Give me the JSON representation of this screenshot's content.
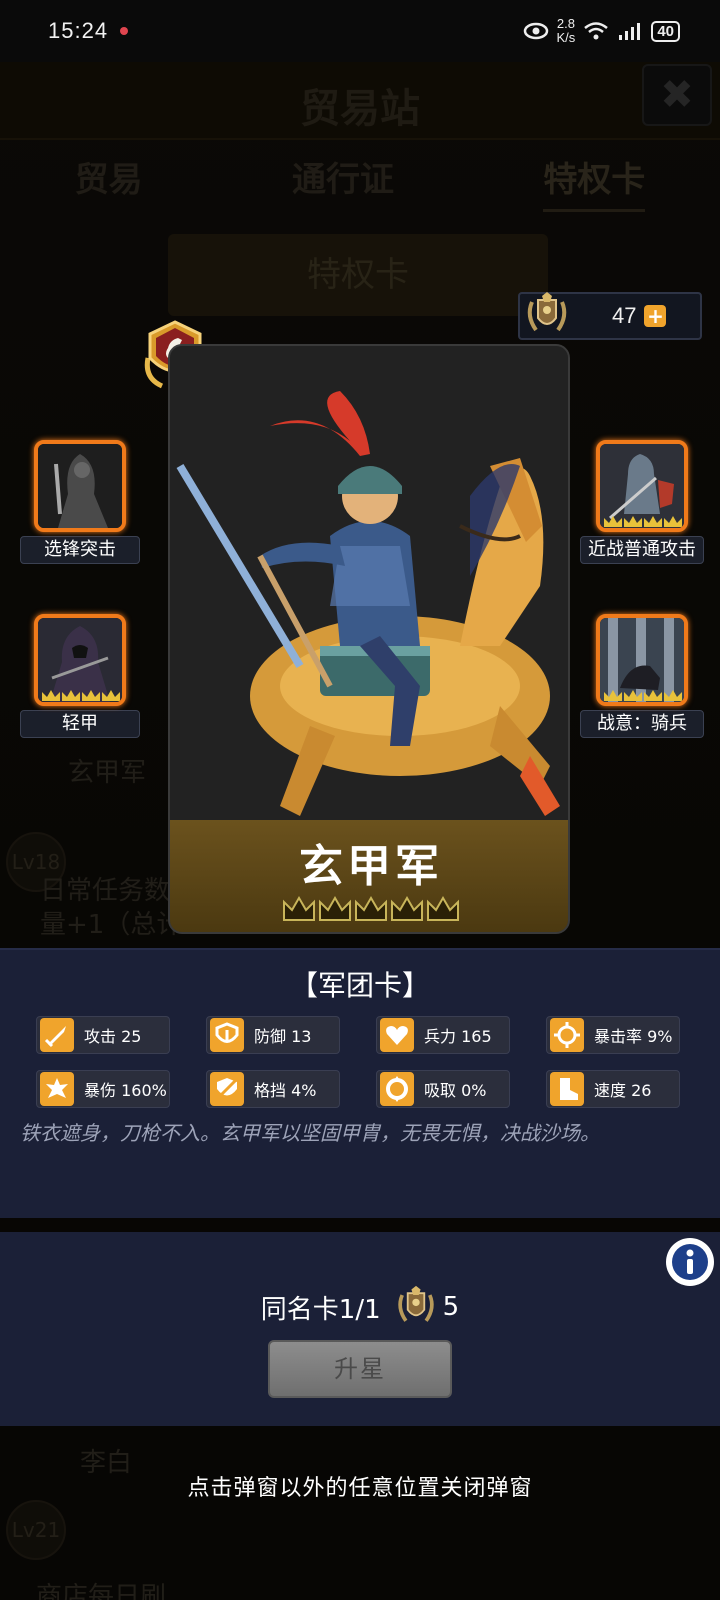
{
  "status_bar": {
    "time": "15:24",
    "speed_top": "2.8",
    "speed_bottom": "K/s",
    "battery": "40"
  },
  "background": {
    "title": "贸易站",
    "tabs": [
      "贸易",
      "通行证",
      "特权卡"
    ],
    "banner": "特权卡",
    "partial_rows": [
      "玄甲军",
      "日常任务数",
      "量+1（总计",
      "李白",
      "商店每日刷"
    ],
    "levels": [
      "Lv18",
      "Lv21"
    ]
  },
  "currency": {
    "amount": "47",
    "icon": "laurel-shield-emblem",
    "plus_icon": "plus-icon"
  },
  "card": {
    "name": "玄甲军",
    "stars": 5,
    "rank_icon": "knight-chess-icon",
    "type_label": "【军团卡】",
    "skills": [
      {
        "label": "选锋突击"
      },
      {
        "label": "轻甲"
      },
      {
        "label": "近战普通攻击"
      },
      {
        "label": "战意：骑兵"
      }
    ],
    "stats": [
      {
        "label": "攻击 25",
        "icon": "sword-icon"
      },
      {
        "label": "防御 13",
        "icon": "shield-icon"
      },
      {
        "label": "兵力 165",
        "icon": "heart-icon"
      },
      {
        "label": "暴击率 9%",
        "icon": "crosshair-icon"
      },
      {
        "label": "暴伤 160%",
        "icon": "burst-icon"
      },
      {
        "label": "格挡 4%",
        "icon": "block-icon"
      },
      {
        "label": "吸取 0%",
        "icon": "drain-icon"
      },
      {
        "label": "速度 26",
        "icon": "boot-icon"
      }
    ],
    "flavor": "铁衣遮身，刀枪不入。玄甲军以坚固甲胄，无畏无惧，决战沙场。"
  },
  "upgrade": {
    "dup_label": "同名卡1/1",
    "cost": "5",
    "button": "升星"
  },
  "close_hint": "点击弹窗以外的任意位置关闭弹窗",
  "colors": {
    "accent_orange": "#f0a42c",
    "skill_frame": "#f07a1a",
    "panel": "#1b2037"
  }
}
